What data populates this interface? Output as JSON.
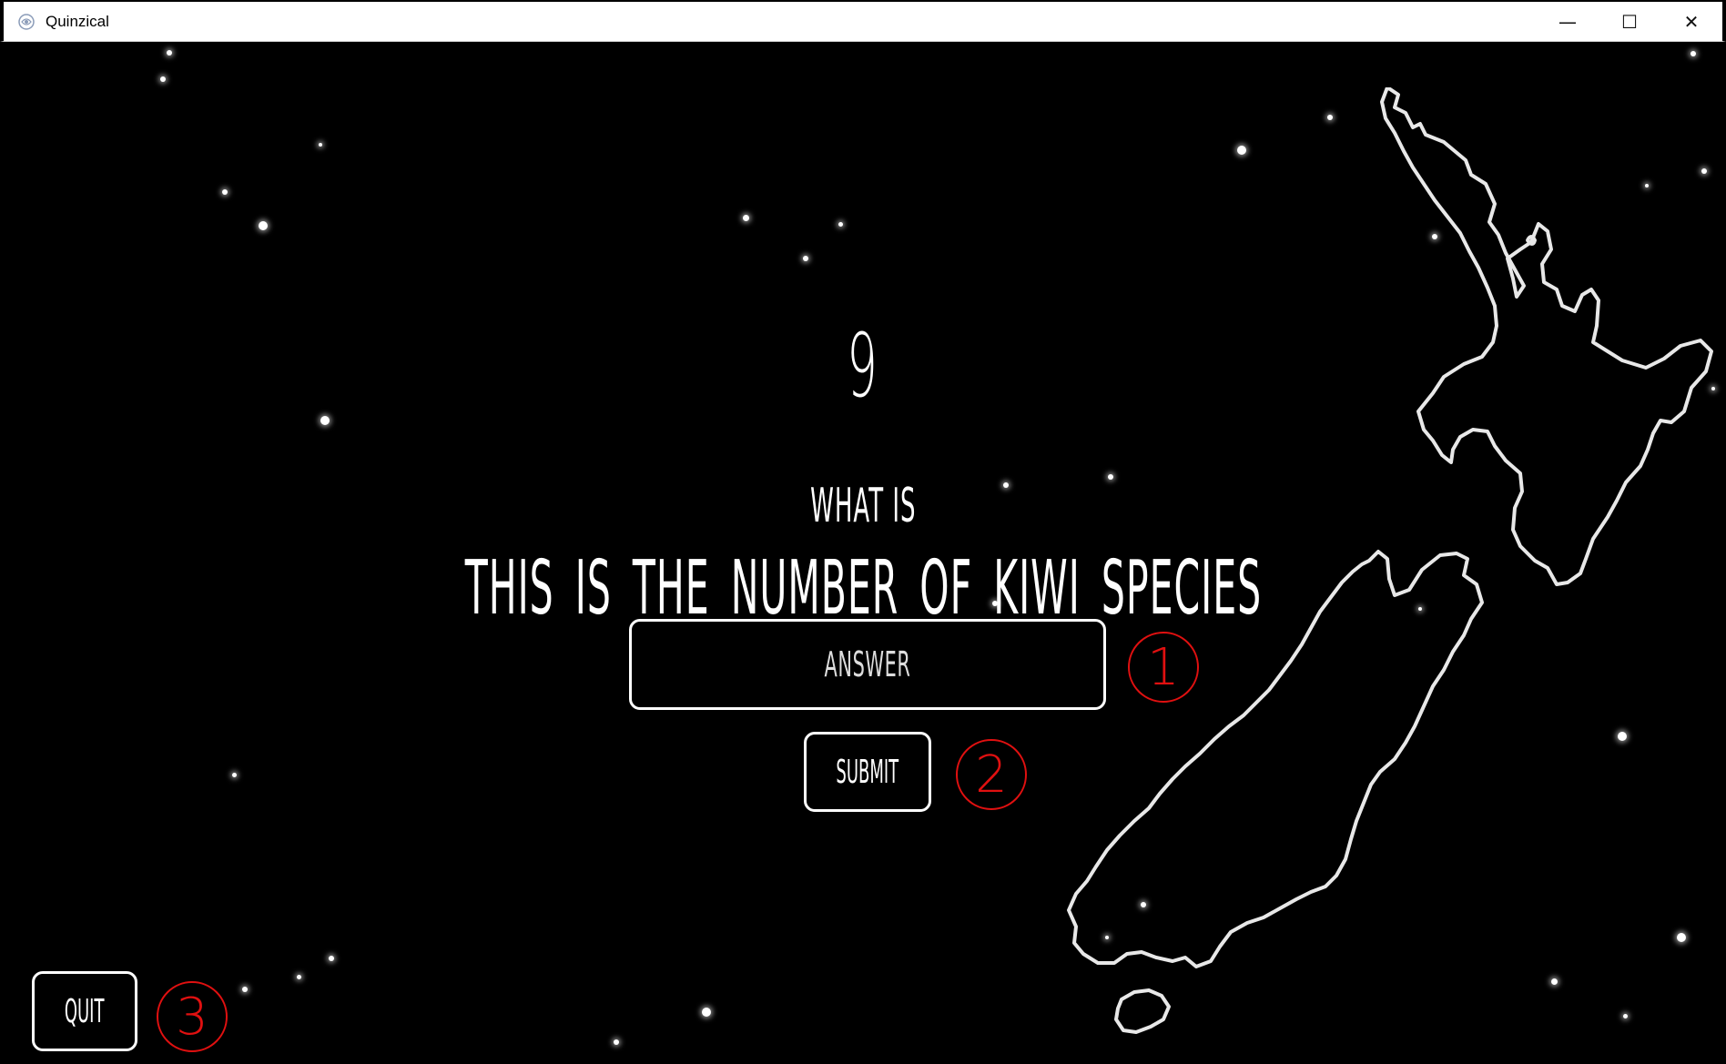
{
  "window": {
    "title": "Quinzical",
    "minimize_glyph": "—",
    "maximize_glyph": "☐",
    "close_glyph": "✕"
  },
  "question": {
    "value": "9",
    "prompt": "WHAT IS",
    "clue": "THIS IS THE NUMBER OF KIWI SPECIES"
  },
  "answer_input": {
    "placeholder": "ANSWER",
    "value": ""
  },
  "buttons": {
    "submit_label": "SUBMIT",
    "quit_label": "QUIT"
  },
  "annotations": {
    "marker_1": "1",
    "marker_2": "2",
    "marker_3": "3",
    "color": "#e01010"
  },
  "icons": {
    "app": "app-logo-icon",
    "map": "new-zealand-map-outline"
  },
  "colors": {
    "background": "#000000",
    "foreground": "#ffffff"
  }
}
